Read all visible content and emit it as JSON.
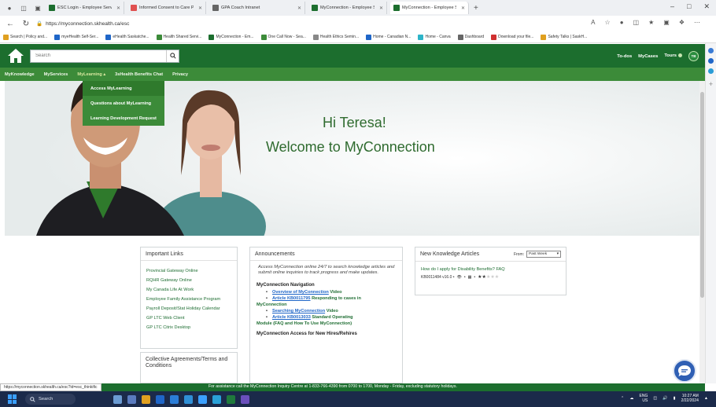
{
  "browser": {
    "tabs": [
      {
        "label": "ESC Login - Employee Service Cer",
        "color": "#1c6e2e"
      },
      {
        "label": "Informed Consent to Care Policy",
        "color": "#e05050"
      },
      {
        "label": "GPA Coach Intranet",
        "color": "#666666"
      },
      {
        "label": "MyConnection - Employee Service",
        "color": "#1c6e2e"
      },
      {
        "label": "MyConnection - Employee Servi",
        "color": "#1c6e2e",
        "active": true
      }
    ],
    "url": "https://myconnection.skhealth.ca/esc",
    "bookmarks": [
      {
        "label": "Search | Policy and...",
        "color": "#e0a020"
      },
      {
        "label": "myeHealth Self-Ser...",
        "color": "#1f66c8"
      },
      {
        "label": "eHealth Saskatche...",
        "color": "#1f66c8"
      },
      {
        "label": "Health Shared Servi...",
        "color": "#3c8b39"
      },
      {
        "label": "MyConnection - Em...",
        "color": "#1c6e2e"
      },
      {
        "label": "One Call Now - Sea...",
        "color": "#3c8b39"
      },
      {
        "label": "Health Ethics Semin...",
        "color": "#888888"
      },
      {
        "label": "Home - Canadian N...",
        "color": "#1f66c8"
      },
      {
        "label": "Home - Canva",
        "color": "#2db4c8"
      },
      {
        "label": "Dashboard",
        "color": "#666666"
      },
      {
        "label": "Download your file...",
        "color": "#d03030"
      },
      {
        "label": "Safety Talks | SaskH...",
        "color": "#e0a020"
      }
    ]
  },
  "header": {
    "search_placeholder": "Search",
    "todos": "To-dos",
    "mycases": "MyCases",
    "tours": "Tours",
    "avatar_initials": "TB"
  },
  "nav": {
    "items": [
      "MyKnowledge",
      "MyServices",
      "MyLearning ▴",
      "3sHealth Benefits Chat",
      "Privacy"
    ]
  },
  "dropdown": {
    "items": [
      "Access MyLearning",
      "Questions about MyLearning",
      "Learning Development Request"
    ]
  },
  "hero": {
    "greeting": "Hi Teresa!",
    "welcome": "Welcome to MyConnection"
  },
  "important_links": {
    "title": "Important Links",
    "items": [
      "Provincial Gateway Online",
      "RQHR Gateway Online",
      "My Canada Life At Work",
      "Employee Family Assistance Program",
      "Payroll Deposit/Stat Holiday Calendar",
      "GP LTC Web Client",
      "GP LTC Citrix Desktop"
    ]
  },
  "collective": {
    "title": "Collective Agreements/Terms and Conditions"
  },
  "announcements": {
    "title": "Announcements",
    "intro": "Access MyConnection online 24/7 to search knowledge articles and submit online inquiries to track progress and make updates.",
    "nav_heading": "MyConnection Navigation",
    "item1_link": "Overview of MyConnection",
    "item1_rest": " Video",
    "item2_link": "Article KB0011795",
    "item2_rest": " Responding to cases in",
    "item2_cont": "MyConnection",
    "item3_link": "Searching MyConnection",
    "item3_rest": " Video",
    "item4_link": "Article KB0013033",
    "item4_rest": " Standard Operating",
    "item4_cont": "Module (FAQ and How To Use MyConnection)",
    "access_heading": "MyConnection Access for New Hires/Rehires"
  },
  "new_knowledge": {
    "title": "New Knowledge Articles",
    "from_label": "From:",
    "from_value": "Past Week",
    "article_link": "How do I apply for Disability Benefits? FAQ",
    "article_meta": "KB0011484 v16.0 •",
    "rating": 2
  },
  "status": {
    "hover_url": "https://myconnection.skhealth.ca/esc?id=esc_thinkific",
    "footer_text": "For assistance call the MyConnection Inquiry Centre at 1-833-766-4390 from 0700 to 1700, Monday - Friday, excluding statutory holidays."
  },
  "taskbar": {
    "search": "Search",
    "lang": "ENG",
    "region": "US",
    "time": "10:27 AM",
    "date": "2/22/2024"
  }
}
